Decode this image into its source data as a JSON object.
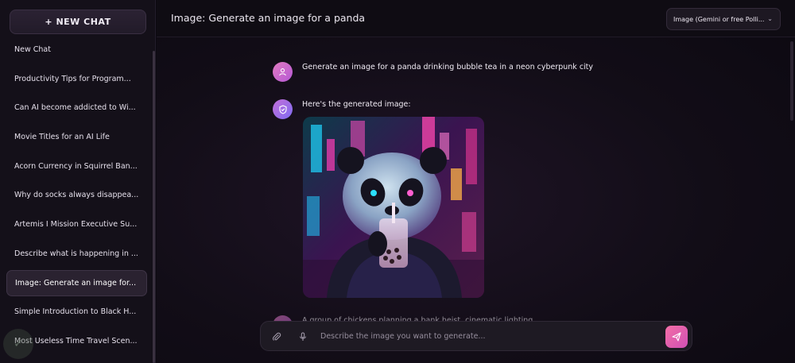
{
  "sidebar": {
    "new_chat_label": "+ NEW CHAT",
    "items": [
      {
        "label": "New Chat"
      },
      {
        "label": "Productivity Tips for Program..."
      },
      {
        "label": "Can AI become addicted to Wi..."
      },
      {
        "label": "Movie Titles for an AI Life"
      },
      {
        "label": "Acorn Currency in Squirrel Ban..."
      },
      {
        "label": "Why do socks always disappea..."
      },
      {
        "label": "Artemis I Mission Executive Su..."
      },
      {
        "label": "Describe what is happening in ..."
      },
      {
        "label": "Image: Generate an image for..."
      },
      {
        "label": "Simple Introduction to Black H..."
      },
      {
        "label": "Most Useless Time Travel Scen..."
      }
    ],
    "active_index": 8
  },
  "header": {
    "title": "Image: Generate an image for a panda",
    "model_select": "Image (Gemini or free Polli...",
    "chevron_icon": "chevron-down-icon"
  },
  "messages": [
    {
      "role": "user",
      "icon": "user-icon",
      "text": "Generate an image for a panda drinking bubble tea in a neon cyberpunk city"
    },
    {
      "role": "assistant",
      "icon": "shield-check-icon",
      "text": "Here's the generated image:",
      "image": "panda-neon-cyberpunk"
    },
    {
      "role": "user",
      "icon": "user-icon",
      "text": "A group of chickens planning a bank heist, cinematic lighting"
    }
  ],
  "composer": {
    "attach_icon": "paperclip-icon",
    "mic_icon": "microphone-icon",
    "placeholder": "Describe the image you want to generate...",
    "send_icon": "send-icon"
  },
  "colors": {
    "accent": "#e45fae",
    "background": "#0c0911",
    "sidebar": "#141019"
  }
}
